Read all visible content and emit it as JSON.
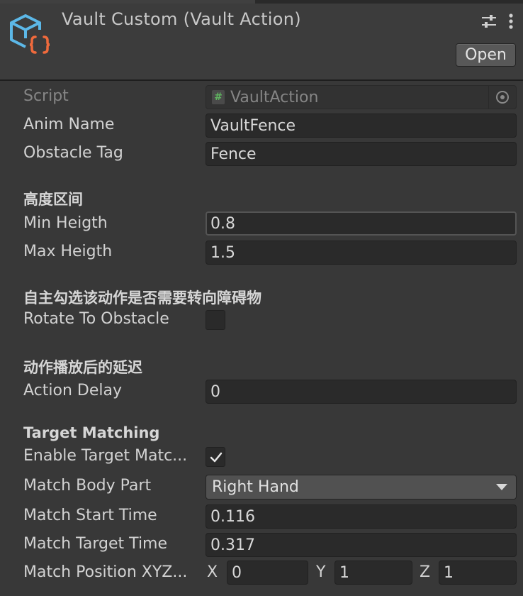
{
  "header": {
    "title": "Vault Custom (Vault Action)",
    "open_button": "Open",
    "icons": [
      "script-component-icon",
      "presets-icon",
      "kebab-menu-icon"
    ]
  },
  "fields": {
    "script": {
      "label": "Script",
      "value": "VaultAction"
    },
    "anim_name": {
      "label": "Anim Name",
      "value": "VaultFence"
    },
    "obstacle_tag": {
      "label": "Obstacle Tag",
      "value": "Fence"
    }
  },
  "height_section": {
    "header": "高度区间",
    "min": {
      "label": "Min Heigth",
      "value": "0.8"
    },
    "max": {
      "label": "Max Heigth",
      "value": "1.5"
    }
  },
  "rotate_section": {
    "header": "自主勾选该动作是否需要转向障碍物",
    "rotate": {
      "label": "Rotate To Obstacle",
      "checked": false
    }
  },
  "delay_section": {
    "header": "动作播放后的延迟",
    "delay": {
      "label": "Action Delay",
      "value": "0"
    }
  },
  "target_section": {
    "header": "Target Matching",
    "enable": {
      "label": "Enable Target Matc...",
      "checked": true
    },
    "body_part": {
      "label": "Match Body Part",
      "value": "Right Hand"
    },
    "start_time": {
      "label": "Match Start Time",
      "value": "0.116"
    },
    "target_time": {
      "label": "Match Target Time",
      "value": "0.317"
    },
    "position": {
      "label": "Match Position XYZ...",
      "x_label": "X",
      "x": "0",
      "y_label": "Y",
      "y": "1",
      "z_label": "Z",
      "z": "1"
    }
  },
  "colors": {
    "background": "#383838",
    "field_bg": "#2a2a2a",
    "icon_blue": "#5cb8e8",
    "icon_orange": "#f06a3c",
    "script_hash_green": "#5fb35f"
  }
}
